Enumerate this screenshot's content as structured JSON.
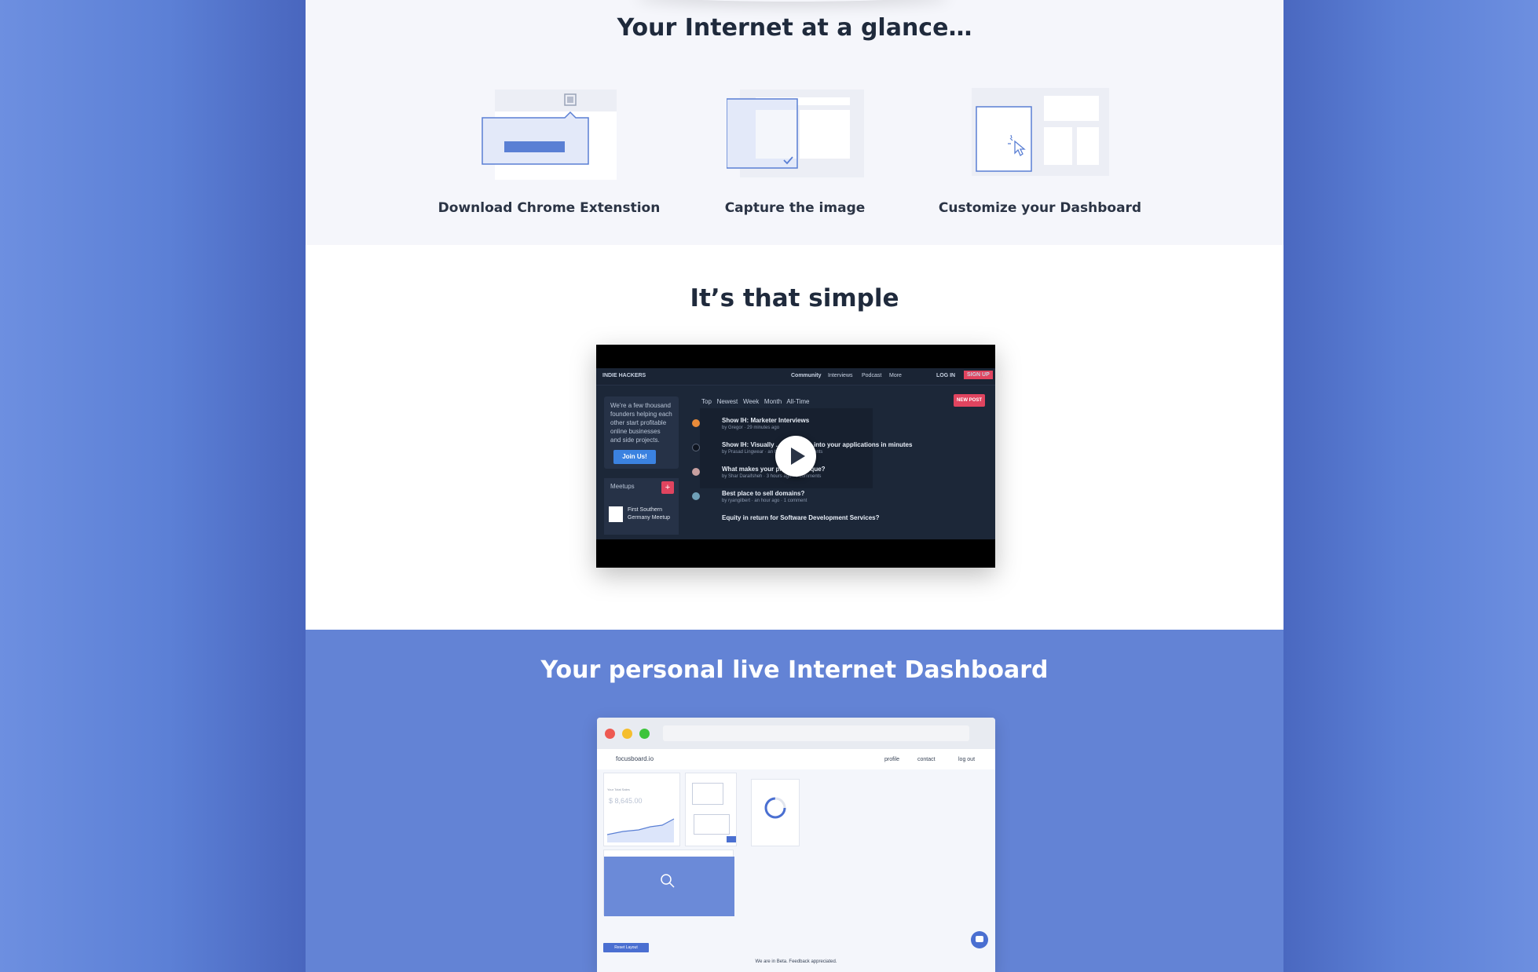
{
  "sections": {
    "glance": {
      "title": "Your Internet at a glance…",
      "steps": [
        {
          "label": "Download Chrome Extenstion",
          "icon": "browser-extension-icon"
        },
        {
          "label": "Capture the image",
          "icon": "capture-image-icon"
        },
        {
          "label": "Customize your Dashboard",
          "icon": "customize-dashboard-icon"
        }
      ]
    },
    "simple": {
      "title": "It’s that simple",
      "video": {
        "site_name": "INDIE HACKERS",
        "nav": [
          "Community",
          "Interviews",
          "Podcast",
          "More",
          "LOG IN",
          "SIGN UP"
        ],
        "intro_text": "We're a few thousand founders helping each other start profitable online businesses and side projects.",
        "join_label": "Join Us!",
        "meetups_label": "Meetups",
        "meetup_item": "First Southern Germany Meetup",
        "tabs": [
          "Top",
          "Newest",
          "Week",
          "Month",
          "All-Time"
        ],
        "new_post_label": "NEW POST",
        "posts": [
          {
            "title": "Show IH: Marketer Interviews",
            "meta": "by Gregor · 29 minutes ago"
          },
          {
            "title": "Show IH: Visually ... and Voice into your applications in minutes",
            "meta": "by Prasad Lingwear · an hour ago · 8 comments"
          },
          {
            "title": "What makes your product unique?",
            "meta": "by Shar Daraifsheh · 3 hours ago · 7 comments"
          },
          {
            "title": "Best place to sell domains?",
            "meta": "by ryangilbert · an hour ago · 1 comment"
          },
          {
            "title": "Equity in return for Software Development Services?",
            "meta": ""
          }
        ]
      }
    },
    "dashboard": {
      "title": "Your personal live Internet Dashboard",
      "app": {
        "logo": "focusboard.io",
        "nav": [
          "profile",
          "contact",
          "log out"
        ],
        "widget_value": "$ 8,645.00",
        "widget_label": "Your Total Sales",
        "reset_label": "Reset Layout",
        "beta_text": "We are in Beta. Feedback appreciated."
      }
    }
  },
  "colors": {
    "accent": "#5a7fd4",
    "dark_text": "#1f2a3c",
    "pink": "#e0445f"
  }
}
